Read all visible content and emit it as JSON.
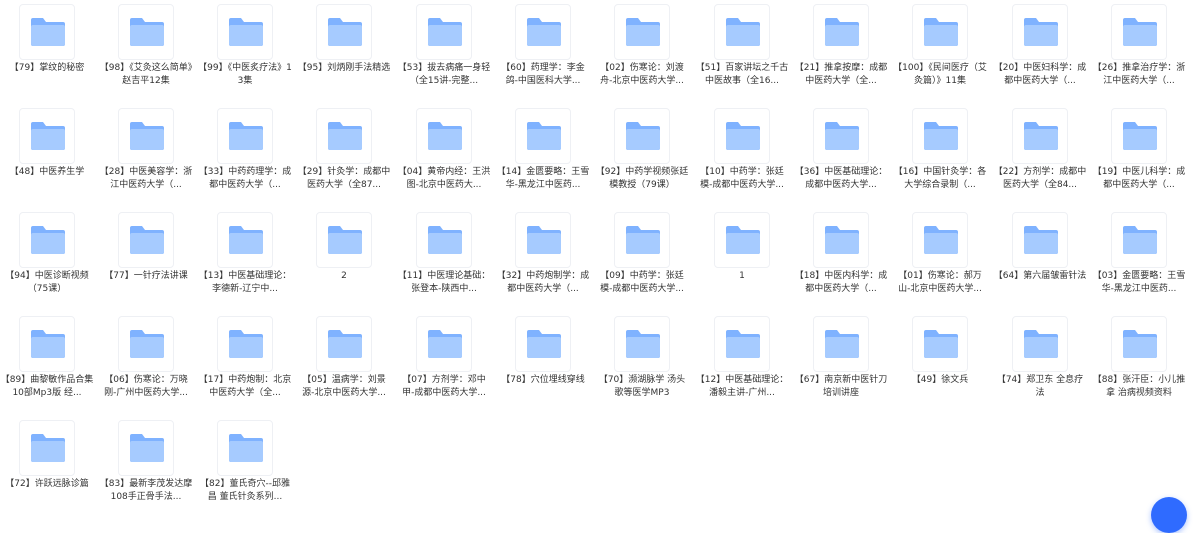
{
  "colors": {
    "folder_back": "#7fb2ff",
    "folder_front": "#a6cbff",
    "fab": "#2f6bff"
  },
  "folders": [
    {
      "label": "【79】掌纹的秘密"
    },
    {
      "label": "【98】《艾灸这么简单》赵吉平12集"
    },
    {
      "label": "【99】《中医炙疗法》13集"
    },
    {
      "label": "【95】刘炳刚手法精选"
    },
    {
      "label": "【53】拔去病痛一身轻（全15讲-完整..."
    },
    {
      "label": "【60】药理学：李金鸽-中国医科大学..."
    },
    {
      "label": "【02】伤寒论：刘渡舟-北京中医药大学..."
    },
    {
      "label": "【51】百家讲坛之千古中医故事（全16..."
    },
    {
      "label": "【21】推拿按摩：成都中医药大学（全..."
    },
    {
      "label": "【100】《民间医疗（艾灸篇）》11集"
    },
    {
      "label": "【20】中医妇科学：成都中医药大学（..."
    },
    {
      "label": "【26】推拿治疗学：浙江中医药大学（..."
    },
    {
      "label": "【48】中医养生学"
    },
    {
      "label": "【28】中医美容学：浙江中医药大学（..."
    },
    {
      "label": "【33】中药药理学：成都中医药大学（..."
    },
    {
      "label": "【29】针灸学：成都中医药大学（全87..."
    },
    {
      "label": "【04】黄帝内经：王洪图-北京中医药大..."
    },
    {
      "label": "【14】金匮要略：王雪华-黑龙江中医药..."
    },
    {
      "label": "【92】中药学视频张廷模教授（79课）"
    },
    {
      "label": "【10】中药学：张廷模-成都中医药大学..."
    },
    {
      "label": "【36】中医基础理论：成都中医药大学..."
    },
    {
      "label": "【16】中国针灸学：各大学综合录制（..."
    },
    {
      "label": "【22】方剂学：成都中医药大学（全84..."
    },
    {
      "label": "【19】中医儿科学：成都中医药大学（..."
    },
    {
      "label": "【94】中医诊断视频（75课）"
    },
    {
      "label": "【77】一针疗法讲课"
    },
    {
      "label": "【13】中医基础理论：李德新-辽宁中..."
    },
    {
      "label": "2"
    },
    {
      "label": "【11】中医理论基础：张登本-陕西中..."
    },
    {
      "label": "【32】中药炮制学：成都中医药大学（..."
    },
    {
      "label": "【09】中药学：张廷模-成都中医药大学..."
    },
    {
      "label": "1"
    },
    {
      "label": "【18】中医内科学：成都中医药大学（..."
    },
    {
      "label": "【01】伤寒论：郝万山-北京中医药大学..."
    },
    {
      "label": "【64】第六届皱雷针法"
    },
    {
      "label": "【03】金匮要略：王雪华-黑龙江中医药..."
    },
    {
      "label": "【89】曲黎敏作品合集10部Mp3版 经..."
    },
    {
      "label": "【06】伤寒论：万晓刚-广州中医药大学..."
    },
    {
      "label": "【17】中药炮制：北京中医药大学（全..."
    },
    {
      "label": "【05】温病学：刘景源-北京中医药大学..."
    },
    {
      "label": "【07】方剂学：邓中甲-成都中医药大学..."
    },
    {
      "label": "【78】穴位埋线穿线"
    },
    {
      "label": "【70】濒湖脉学 汤头歌等医学MP3"
    },
    {
      "label": "【12】中医基础理论：潘毅主讲-广州..."
    },
    {
      "label": "【67】南京新中医针刀培训讲座"
    },
    {
      "label": "【49】徐文兵"
    },
    {
      "label": "【74】郑卫东 全息疗法"
    },
    {
      "label": "【88】张汗臣：小儿推拿 治病视频资料"
    },
    {
      "label": "【72】许跃远脉诊篇"
    },
    {
      "label": "【83】最新李茂发达摩108手正骨手法..."
    },
    {
      "label": "【82】董氏奇穴--邱雅昌 董氏针灸系列..."
    }
  ]
}
